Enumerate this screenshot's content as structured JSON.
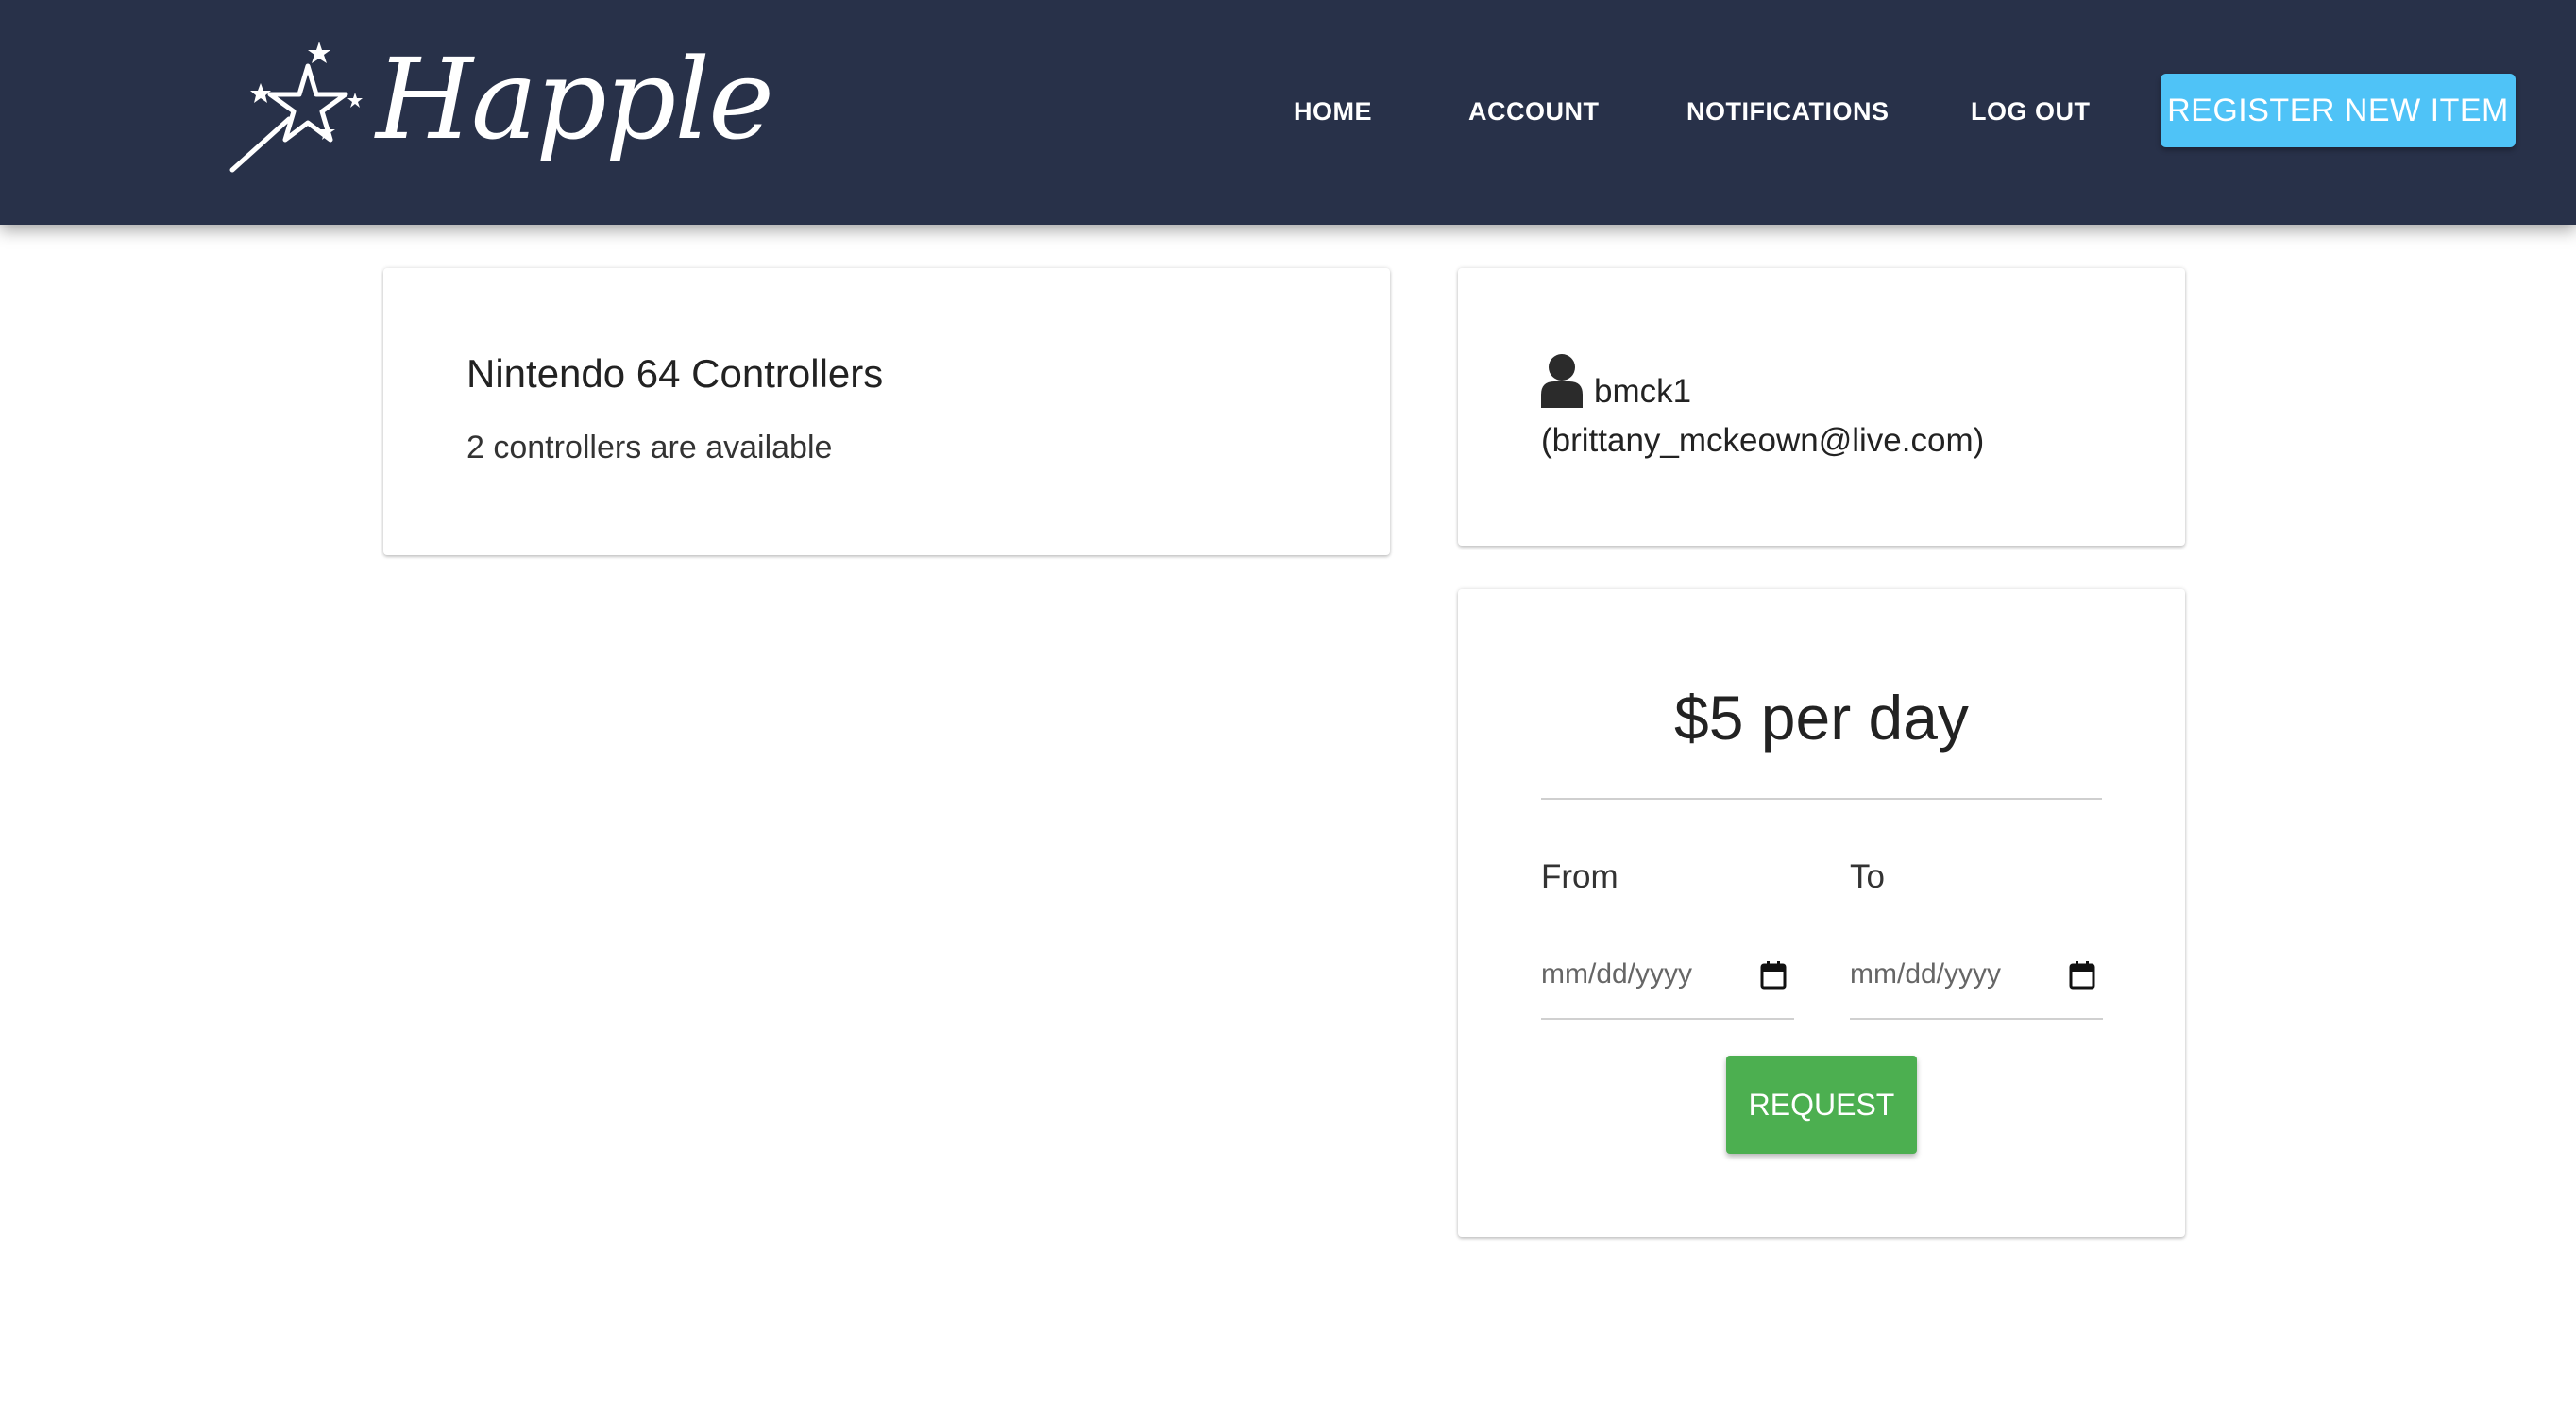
{
  "navbar": {
    "brand_name": "Happle",
    "links": {
      "home": "HOME",
      "account": "ACCOUNT",
      "notifications": "NOTIFICATIONS",
      "logout": "LOG OUT"
    },
    "register_label": "REGISTER NEW ITEM"
  },
  "item": {
    "title": "Nintendo 64 Controllers",
    "description": "2 controllers are available"
  },
  "owner": {
    "username": "bmck1",
    "email": "(brittany_mckeown@live.com)"
  },
  "request": {
    "price": "$5 per day",
    "from_label": "From",
    "to_label": "To",
    "from_placeholder": "mm/dd/yyyy",
    "to_placeholder": "mm/dd/yyyy",
    "button_label": "REQUEST"
  },
  "colors": {
    "navbar_bg": "#283149",
    "register_button": "#4fc3f7",
    "request_button": "#4caf50"
  }
}
